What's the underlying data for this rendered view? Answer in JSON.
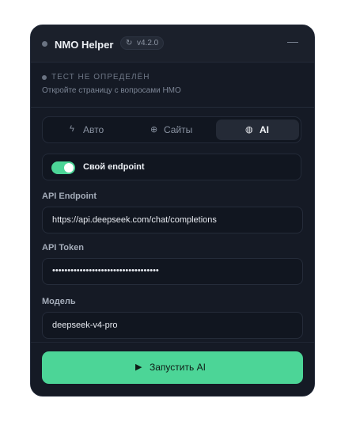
{
  "header": {
    "title": "NMO Helper",
    "version": "v4.2.0",
    "version_icon": "refresh-icon",
    "minimize_label": "—"
  },
  "status": {
    "title": "ТЕСТ НЕ ОПРЕДЕЛЁН",
    "hint": "Откройте страницу с вопросами НМО"
  },
  "tabs": [
    {
      "label": "Авто",
      "icon": "bolt-icon",
      "active": false
    },
    {
      "label": "Сайты",
      "icon": "globe-icon",
      "active": false
    },
    {
      "label": "AI",
      "icon": "brain-icon",
      "active": true
    }
  ],
  "custom_endpoint": {
    "label": "Свой endpoint",
    "enabled": true
  },
  "fields": {
    "endpoint": {
      "label": "API Endpoint",
      "value": "https://api.deepseek.com/chat/completions"
    },
    "token": {
      "label": "API Token",
      "value": "•••••••••••••••••••••••••••••••••••"
    },
    "model": {
      "label": "Модель",
      "value": "deepseek-v4-pro"
    }
  },
  "actions": {
    "run_label": "Запустить AI",
    "run_icon": "play-icon"
  },
  "colors": {
    "accent": "#4cd597",
    "panel_bg": "#151a25",
    "input_bg": "#111620"
  }
}
